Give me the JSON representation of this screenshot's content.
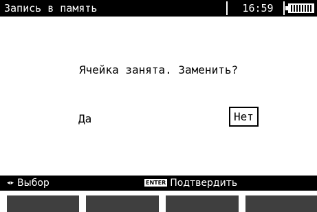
{
  "header": {
    "title": "Запись в память",
    "time": "16:59"
  },
  "icons": {
    "battery": "battery-full-icon",
    "navigation": "left-right-arrows-icon",
    "enter": "enter-key-icon"
  },
  "dialog": {
    "question": "Ячейка занята. Заменить?",
    "options": {
      "yes": "Да",
      "no": "Нет"
    },
    "selected": "no"
  },
  "hints": {
    "navigation_glyph": "◂▸",
    "navigation_label": "Выбор",
    "enter_key": "ENTER",
    "confirm_label": "Подтвердить"
  },
  "colors": {
    "background": "#ffffff",
    "bar": "#000000",
    "softkey": "#3f3f3f"
  }
}
